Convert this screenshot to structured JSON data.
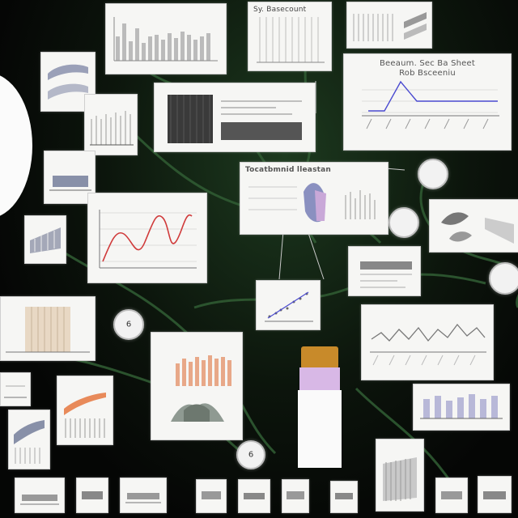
{
  "scene": {
    "colors": {
      "background": "#060806",
      "vine": "#2f5a32",
      "card": "#f6f6f4",
      "accent_red": "#d03a3a",
      "accent_orange": "#e88a5a",
      "accent_blue": "#4a4ad0",
      "tube_cap": "#c88a2a",
      "tube_band": "#d8b8e6"
    },
    "captions": {
      "wide_left_top": "",
      "center_top": "Sy. Basecount",
      "right_top": "",
      "big_right": "Beeaum. Sec Ba Sheet",
      "big_right_line2": "Rob Bsceeniu",
      "center_mid": "Tocatbmnid lleastan",
      "center_mid_sub": ""
    },
    "orbs": [
      "6",
      "6"
    ],
    "icons": [
      "vine-network",
      "moon-shape",
      "sample-tube",
      "ellipse-badge"
    ]
  }
}
